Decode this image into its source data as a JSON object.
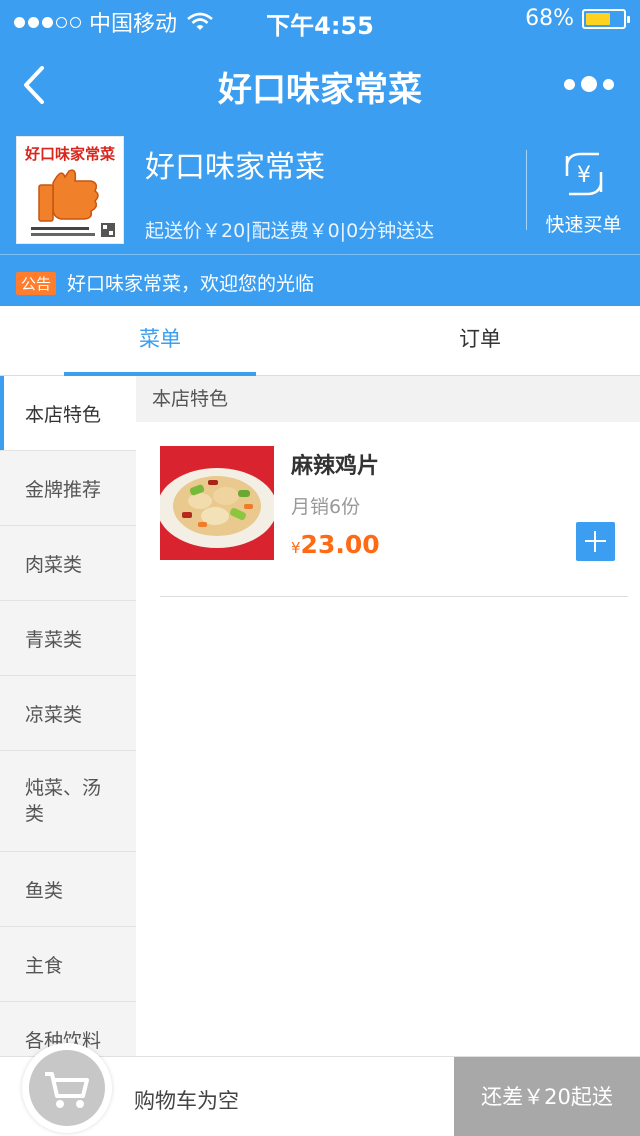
{
  "status_bar": {
    "carrier": "中国移动",
    "time": "下午4:55",
    "battery_text": "68%",
    "battery_level": 0.68
  },
  "nav": {
    "title": "好口味家常菜"
  },
  "shop": {
    "name": "好口味家常菜",
    "logo_text": "好口味家常菜",
    "meta": "起送价￥20|配送费￥0|0分钟送达",
    "quick_order_label": "快速买单",
    "notice_tag": "公告",
    "notice_text": "好口味家常菜，欢迎您的光临"
  },
  "tabs": [
    {
      "label": "菜单",
      "active": true
    },
    {
      "label": "订单",
      "active": false
    }
  ],
  "categories": [
    {
      "label": "本店特色",
      "active": true
    },
    {
      "label": "金牌推荐"
    },
    {
      "label": "肉菜类"
    },
    {
      "label": "青菜类"
    },
    {
      "label": "凉菜类"
    },
    {
      "label": "炖菜、汤类"
    },
    {
      "label": "鱼类"
    },
    {
      "label": "主食"
    },
    {
      "label": "各种饮料"
    }
  ],
  "section_title": "本店特色",
  "dishes": [
    {
      "name": "麻辣鸡片",
      "sales": "月销6份",
      "currency": "¥",
      "price": "23.00"
    }
  ],
  "cart": {
    "empty_text": "购物车为空",
    "checkout_text": "还差￥20起送"
  },
  "colors": {
    "primary": "#3b9ef0",
    "price": "#ff6a14",
    "notice_tag": "#ff7d2d",
    "checkout_disabled": "#a8a8a8"
  },
  "icons": [
    "back-arrow-icon",
    "more-dots-icon",
    "yuan-exchange-icon",
    "cart-icon",
    "plus-icon"
  ]
}
